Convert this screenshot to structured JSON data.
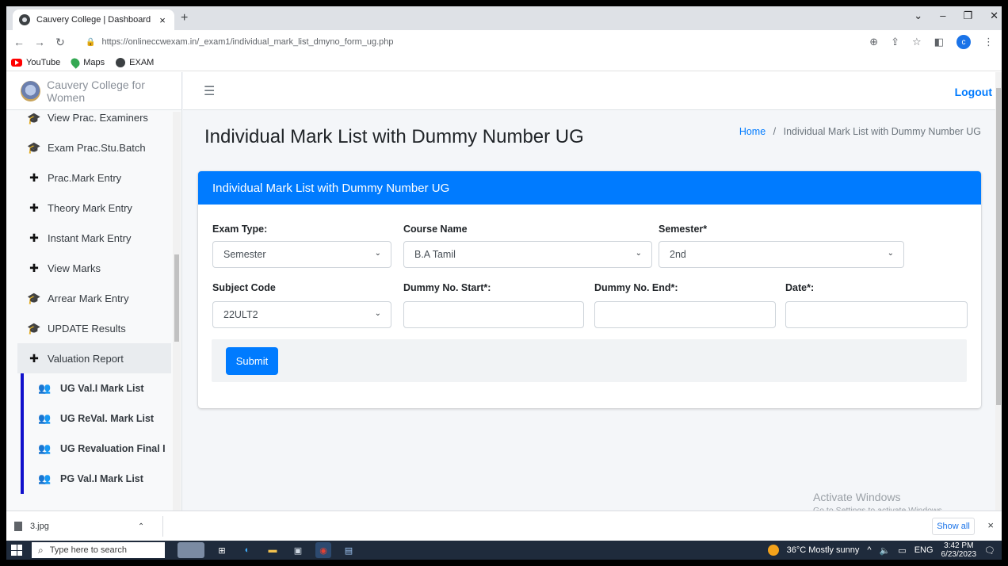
{
  "browser": {
    "tab_title": "Cauvery College | Dashboard",
    "tab_close": "×",
    "new_tab": "+",
    "url": "https://onlineccwexam.in/_exam1/individual_mark_list_dmyno_form_ug.php",
    "bookmarks": [
      {
        "label": "YouTube",
        "icon": "youtube-icon"
      },
      {
        "label": "Maps",
        "icon": "maps-icon"
      },
      {
        "label": "EXAM",
        "icon": "globe-icon"
      }
    ],
    "profile_initial": "c"
  },
  "sidebar": {
    "brand": "Cauvery College for Women",
    "items": [
      {
        "label": "View Prac. Examiners",
        "icon": "graduation-cap-icon"
      },
      {
        "label": "Exam Prac.Stu.Batch",
        "icon": "graduation-cap-icon"
      },
      {
        "label": "Prac.Mark Entry",
        "icon": "plus-icon"
      },
      {
        "label": "Theory Mark Entry",
        "icon": "plus-icon"
      },
      {
        "label": "Instant Mark Entry",
        "icon": "plus-icon"
      },
      {
        "label": "View Marks",
        "icon": "plus-icon"
      },
      {
        "label": "Arrear Mark Entry",
        "icon": "graduation-cap-icon"
      },
      {
        "label": "UPDATE Results",
        "icon": "graduation-cap-icon"
      },
      {
        "label": "Valuation Report",
        "icon": "plus-icon"
      }
    ],
    "subitems": [
      {
        "label": "UG Val.I Mark List"
      },
      {
        "label": "UG ReVal. Mark List"
      },
      {
        "label": "UG Revaluation Final I"
      },
      {
        "label": "PG Val.I Mark List"
      }
    ]
  },
  "topnav": {
    "logout": "Logout"
  },
  "header": {
    "title": "Individual Mark List with Dummy Number UG",
    "breadcrumb_home": "Home",
    "breadcrumb_sep": "/",
    "breadcrumb_current": "Individual Mark List with Dummy Number UG"
  },
  "form": {
    "card_title": "Individual Mark List with Dummy Number UG",
    "exam_type_label": "Exam Type:",
    "exam_type_value": "Semester",
    "course_label": "Course Name",
    "course_value": "B.A Tamil",
    "semester_label": "Semester*",
    "semester_value": "2nd",
    "subject_label": "Subject Code",
    "subject_value": "22ULT2",
    "dummy_start_label": "Dummy No. Start*:",
    "dummy_start_value": "",
    "dummy_end_label": "Dummy No. End*:",
    "dummy_end_value": "",
    "date_label": "Date*:",
    "date_value": "",
    "submit_label": "Submit"
  },
  "watermark": {
    "line1": "Activate Windows",
    "line2": "Go to Settings to activate Windows."
  },
  "downloads": {
    "file": "3.jpg",
    "show_all": "Show all",
    "close": "×"
  },
  "taskbar": {
    "search_placeholder": "Type here to search",
    "weather": "36°C  Mostly sunny",
    "lang": "ENG",
    "time": "3:42 PM",
    "date": "6/23/2023"
  }
}
